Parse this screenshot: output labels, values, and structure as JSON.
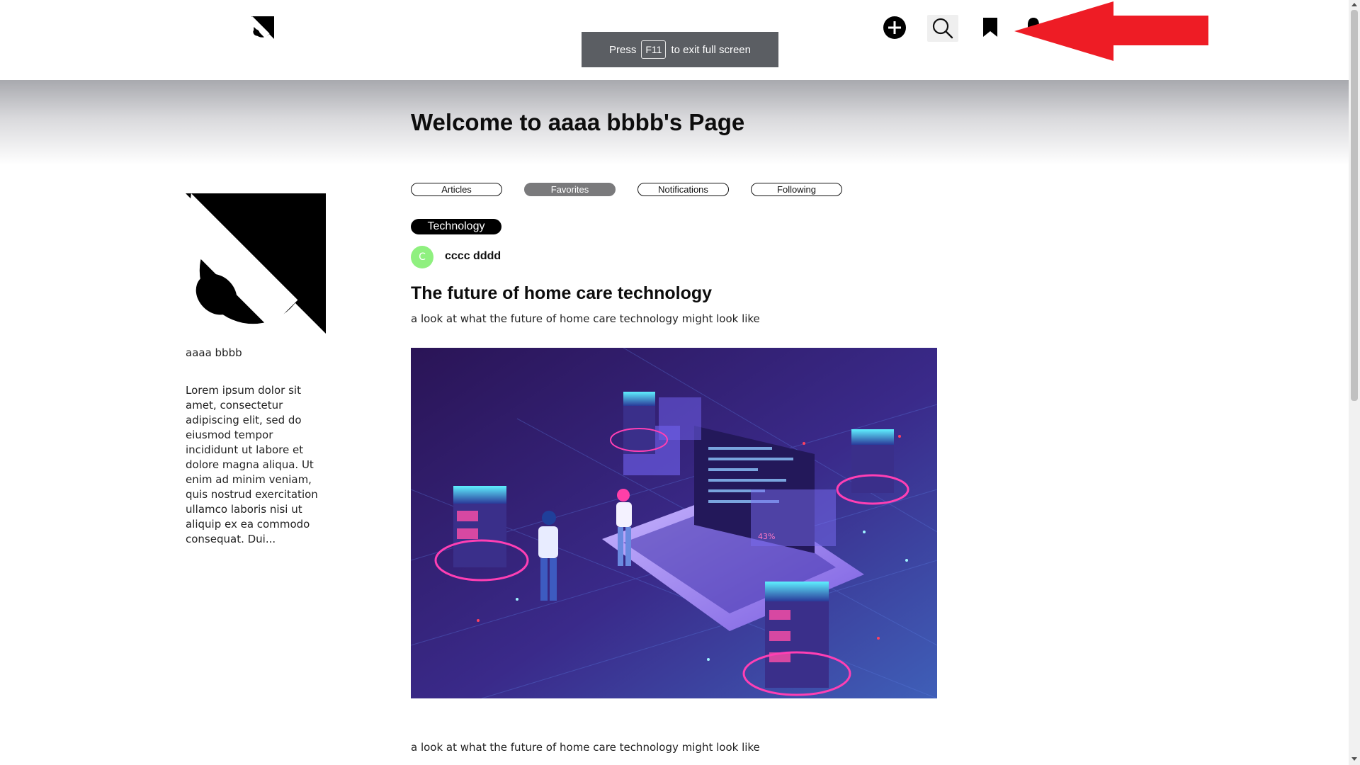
{
  "header": {
    "logo_icon": "site-logo-icon",
    "icons": [
      "plus-circle-icon",
      "search-icon",
      "bookmark-icon",
      "bell-icon"
    ]
  },
  "fullscreen_toast": {
    "press": "Press",
    "key": "F11",
    "suffix": "to exit full screen"
  },
  "page": {
    "title": "Welcome to aaaa bbbb's Page"
  },
  "tabs": [
    {
      "label": "Articles",
      "active": false
    },
    {
      "label": "Favorites",
      "active": true
    },
    {
      "label": "Notifications",
      "active": false
    },
    {
      "label": "Following",
      "active": false
    }
  ],
  "profile": {
    "name": "aaaa bbbb",
    "bio": "Lorem ipsum dolor sit amet, consectetur adipiscing elit, sed do eiusmod tempor incididunt ut labore et dolore magna aliqua. Ut enim ad minim veniam, quis nostrud exercitation ullamco laboris nisi ut aliquip ex ea commodo consequat. Dui..."
  },
  "article": {
    "tag": "Technology",
    "author_initial": "C",
    "author_name": "cccc dddd",
    "title": "The future of home care technology",
    "subtitle": "a look at what the future of home care technology might look like",
    "body": "a look at what the future of home care technology might look like",
    "image_label": "43%"
  },
  "colors": {
    "annotation_arrow": "#ee1c25",
    "avatar": "#8ff07f",
    "active_tab": "#7a7a7c",
    "toast": "#5b5e63"
  }
}
